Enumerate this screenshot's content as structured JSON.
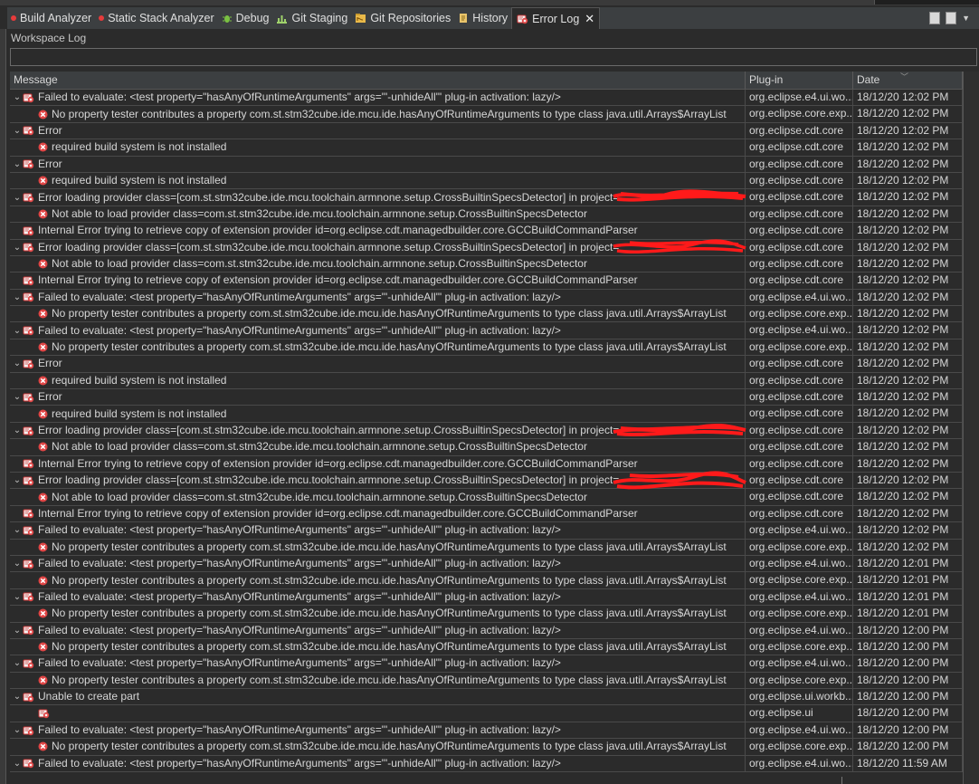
{
  "tabs": [
    {
      "label": "Build Analyzer",
      "icon": "red-dot-icon"
    },
    {
      "label": "Static Stack Analyzer",
      "icon": "red-dot-icon"
    },
    {
      "label": "Debug",
      "icon": "debug-icon"
    },
    {
      "label": "Git Staging",
      "icon": "git-staging-icon"
    },
    {
      "label": "Git Repositories",
      "icon": "git-repositories-icon"
    },
    {
      "label": "History",
      "icon": "history-icon"
    },
    {
      "label": "Error Log",
      "icon": "error-log-icon",
      "active": true
    }
  ],
  "panel_title": "Workspace Log",
  "filter": {
    "value": "",
    "placeholder": ""
  },
  "columns": {
    "message": "Message",
    "plugin": "Plug-in",
    "date": "Date"
  },
  "rows": [
    {
      "lvl": 0,
      "exp": true,
      "m": "Failed to evaluate: <test property=\"hasAnyOfRuntimeArguments\" args=\"'-unhideAll'\" plug-in activation: lazy/>",
      "p": "org.eclipse.e4.ui.wo...",
      "d": "18/12/20 12:02 PM"
    },
    {
      "lvl": 1,
      "m": "No property tester contributes a property com.st.stm32cube.ide.mcu.ide.hasAnyOfRuntimeArguments to type class java.util.Arrays$ArrayList",
      "p": "org.eclipse.core.exp...",
      "d": "18/12/20 12:02 PM"
    },
    {
      "lvl": 0,
      "exp": true,
      "m": "Error",
      "p": "org.eclipse.cdt.core",
      "d": "18/12/20 12:02 PM"
    },
    {
      "lvl": 1,
      "m": "required build system is not installed",
      "p": "org.eclipse.cdt.core",
      "d": "18/12/20 12:02 PM"
    },
    {
      "lvl": 0,
      "exp": true,
      "m": "Error",
      "p": "org.eclipse.cdt.core",
      "d": "18/12/20 12:02 PM"
    },
    {
      "lvl": 1,
      "m": "required build system is not installed",
      "p": "org.eclipse.cdt.core",
      "d": "18/12/20 12:02 PM"
    },
    {
      "lvl": 0,
      "exp": true,
      "m": "Error loading provider class=[com.st.stm32cube.ide.mcu.toolchain.armnone.setup.CrossBuiltinSpecsDetector] in project=",
      "p": "org.eclipse.cdt.core",
      "d": "18/12/20 12:02 PM"
    },
    {
      "lvl": 1,
      "m": "Not able to load provider class=com.st.stm32cube.ide.mcu.toolchain.armnone.setup.CrossBuiltinSpecsDetector",
      "p": "org.eclipse.cdt.core",
      "d": "18/12/20 12:02 PM"
    },
    {
      "lvl": 0,
      "m": "Internal Error trying to retrieve copy of extension provider id=org.eclipse.cdt.managedbuilder.core.GCCBuildCommandParser",
      "p": "org.eclipse.cdt.core",
      "d": "18/12/20 12:02 PM"
    },
    {
      "lvl": 0,
      "exp": true,
      "m": "Error loading provider class=[com.st.stm32cube.ide.mcu.toolchain.armnone.setup.CrossBuiltinSpecsDetector] in project=",
      "p": "org.eclipse.cdt.core",
      "d": "18/12/20 12:02 PM"
    },
    {
      "lvl": 1,
      "m": "Not able to load provider class=com.st.stm32cube.ide.mcu.toolchain.armnone.setup.CrossBuiltinSpecsDetector",
      "p": "org.eclipse.cdt.core",
      "d": "18/12/20 12:02 PM"
    },
    {
      "lvl": 0,
      "m": "Internal Error trying to retrieve copy of extension provider id=org.eclipse.cdt.managedbuilder.core.GCCBuildCommandParser",
      "p": "org.eclipse.cdt.core",
      "d": "18/12/20 12:02 PM"
    },
    {
      "lvl": 0,
      "exp": true,
      "m": "Failed to evaluate: <test property=\"hasAnyOfRuntimeArguments\" args=\"'-unhideAll'\" plug-in activation: lazy/>",
      "p": "org.eclipse.e4.ui.wo...",
      "d": "18/12/20 12:02 PM"
    },
    {
      "lvl": 1,
      "m": "No property tester contributes a property com.st.stm32cube.ide.mcu.ide.hasAnyOfRuntimeArguments to type class java.util.Arrays$ArrayList",
      "p": "org.eclipse.core.exp...",
      "d": "18/12/20 12:02 PM"
    },
    {
      "lvl": 0,
      "exp": true,
      "m": "Failed to evaluate: <test property=\"hasAnyOfRuntimeArguments\" args=\"'-unhideAll'\" plug-in activation: lazy/>",
      "p": "org.eclipse.e4.ui.wo...",
      "d": "18/12/20 12:02 PM"
    },
    {
      "lvl": 1,
      "m": "No property tester contributes a property com.st.stm32cube.ide.mcu.ide.hasAnyOfRuntimeArguments to type class java.util.Arrays$ArrayList",
      "p": "org.eclipse.core.exp...",
      "d": "18/12/20 12:02 PM"
    },
    {
      "lvl": 0,
      "exp": true,
      "m": "Error",
      "p": "org.eclipse.cdt.core",
      "d": "18/12/20 12:02 PM"
    },
    {
      "lvl": 1,
      "m": "required build system is not installed",
      "p": "org.eclipse.cdt.core",
      "d": "18/12/20 12:02 PM"
    },
    {
      "lvl": 0,
      "exp": true,
      "m": "Error",
      "p": "org.eclipse.cdt.core",
      "d": "18/12/20 12:02 PM"
    },
    {
      "lvl": 1,
      "m": "required build system is not installed",
      "p": "org.eclipse.cdt.core",
      "d": "18/12/20 12:02 PM"
    },
    {
      "lvl": 0,
      "exp": true,
      "m": "Error loading provider class=[com.st.stm32cube.ide.mcu.toolchain.armnone.setup.CrossBuiltinSpecsDetector] in project=",
      "p": "org.eclipse.cdt.core",
      "d": "18/12/20 12:02 PM"
    },
    {
      "lvl": 1,
      "m": "Not able to load provider class=com.st.stm32cube.ide.mcu.toolchain.armnone.setup.CrossBuiltinSpecsDetector",
      "p": "org.eclipse.cdt.core",
      "d": "18/12/20 12:02 PM"
    },
    {
      "lvl": 0,
      "m": "Internal Error trying to retrieve copy of extension provider id=org.eclipse.cdt.managedbuilder.core.GCCBuildCommandParser",
      "p": "org.eclipse.cdt.core",
      "d": "18/12/20 12:02 PM"
    },
    {
      "lvl": 0,
      "exp": true,
      "m": "Error loading provider class=[com.st.stm32cube.ide.mcu.toolchain.armnone.setup.CrossBuiltinSpecsDetector] in project=",
      "p": "org.eclipse.cdt.core",
      "d": "18/12/20 12:02 PM"
    },
    {
      "lvl": 1,
      "m": "Not able to load provider class=com.st.stm32cube.ide.mcu.toolchain.armnone.setup.CrossBuiltinSpecsDetector",
      "p": "org.eclipse.cdt.core",
      "d": "18/12/20 12:02 PM"
    },
    {
      "lvl": 0,
      "m": "Internal Error trying to retrieve copy of extension provider id=org.eclipse.cdt.managedbuilder.core.GCCBuildCommandParser",
      "p": "org.eclipse.cdt.core",
      "d": "18/12/20 12:02 PM"
    },
    {
      "lvl": 0,
      "exp": true,
      "m": "Failed to evaluate: <test property=\"hasAnyOfRuntimeArguments\" args=\"'-unhideAll'\" plug-in activation: lazy/>",
      "p": "org.eclipse.e4.ui.wo...",
      "d": "18/12/20 12:02 PM"
    },
    {
      "lvl": 1,
      "m": "No property tester contributes a property com.st.stm32cube.ide.mcu.ide.hasAnyOfRuntimeArguments to type class java.util.Arrays$ArrayList",
      "p": "org.eclipse.core.exp...",
      "d": "18/12/20 12:02 PM"
    },
    {
      "lvl": 0,
      "exp": true,
      "m": "Failed to evaluate: <test property=\"hasAnyOfRuntimeArguments\" args=\"'-unhideAll'\" plug-in activation: lazy/>",
      "p": "org.eclipse.e4.ui.wo...",
      "d": "18/12/20 12:01 PM"
    },
    {
      "lvl": 1,
      "m": "No property tester contributes a property com.st.stm32cube.ide.mcu.ide.hasAnyOfRuntimeArguments to type class java.util.Arrays$ArrayList",
      "p": "org.eclipse.core.exp...",
      "d": "18/12/20 12:01 PM"
    },
    {
      "lvl": 0,
      "exp": true,
      "m": "Failed to evaluate: <test property=\"hasAnyOfRuntimeArguments\" args=\"'-unhideAll'\" plug-in activation: lazy/>",
      "p": "org.eclipse.e4.ui.wo...",
      "d": "18/12/20 12:01 PM"
    },
    {
      "lvl": 1,
      "m": "No property tester contributes a property com.st.stm32cube.ide.mcu.ide.hasAnyOfRuntimeArguments to type class java.util.Arrays$ArrayList",
      "p": "org.eclipse.core.exp...",
      "d": "18/12/20 12:01 PM"
    },
    {
      "lvl": 0,
      "exp": true,
      "m": "Failed to evaluate: <test property=\"hasAnyOfRuntimeArguments\" args=\"'-unhideAll'\" plug-in activation: lazy/>",
      "p": "org.eclipse.e4.ui.wo...",
      "d": "18/12/20 12:00 PM"
    },
    {
      "lvl": 1,
      "m": "No property tester contributes a property com.st.stm32cube.ide.mcu.ide.hasAnyOfRuntimeArguments to type class java.util.Arrays$ArrayList",
      "p": "org.eclipse.core.exp...",
      "d": "18/12/20 12:00 PM"
    },
    {
      "lvl": 0,
      "exp": true,
      "m": "Failed to evaluate: <test property=\"hasAnyOfRuntimeArguments\" args=\"'-unhideAll'\" plug-in activation: lazy/>",
      "p": "org.eclipse.e4.ui.wo...",
      "d": "18/12/20 12:00 PM"
    },
    {
      "lvl": 1,
      "m": "No property tester contributes a property com.st.stm32cube.ide.mcu.ide.hasAnyOfRuntimeArguments to type class java.util.Arrays$ArrayList",
      "p": "org.eclipse.core.exp...",
      "d": "18/12/20 12:00 PM"
    },
    {
      "lvl": 0,
      "exp": true,
      "m": "Unable to create part",
      "p": "org.eclipse.ui.workb...",
      "d": "18/12/20 12:00 PM"
    },
    {
      "lvl": 1,
      "m": "",
      "p": "org.eclipse.ui",
      "d": "18/12/20 12:00 PM",
      "iconType": "plugin"
    },
    {
      "lvl": 0,
      "exp": true,
      "m": "Failed to evaluate: <test property=\"hasAnyOfRuntimeArguments\" args=\"'-unhideAll'\" plug-in activation: lazy/>",
      "p": "org.eclipse.e4.ui.wo...",
      "d": "18/12/20 12:00 PM"
    },
    {
      "lvl": 1,
      "m": "No property tester contributes a property com.st.stm32cube.ide.mcu.ide.hasAnyOfRuntimeArguments to type class java.util.Arrays$ArrayList",
      "p": "org.eclipse.core.exp...",
      "d": "18/12/20 12:00 PM"
    },
    {
      "lvl": 0,
      "exp": true,
      "m": "Failed to evaluate: <test property=\"hasAnyOfRuntimeArguments\" args=\"'-unhideAll'\" plug-in activation: lazy/>",
      "p": "org.eclipse.e4.ui.wo...",
      "d": "18/12/20 11:59 AM"
    }
  ]
}
